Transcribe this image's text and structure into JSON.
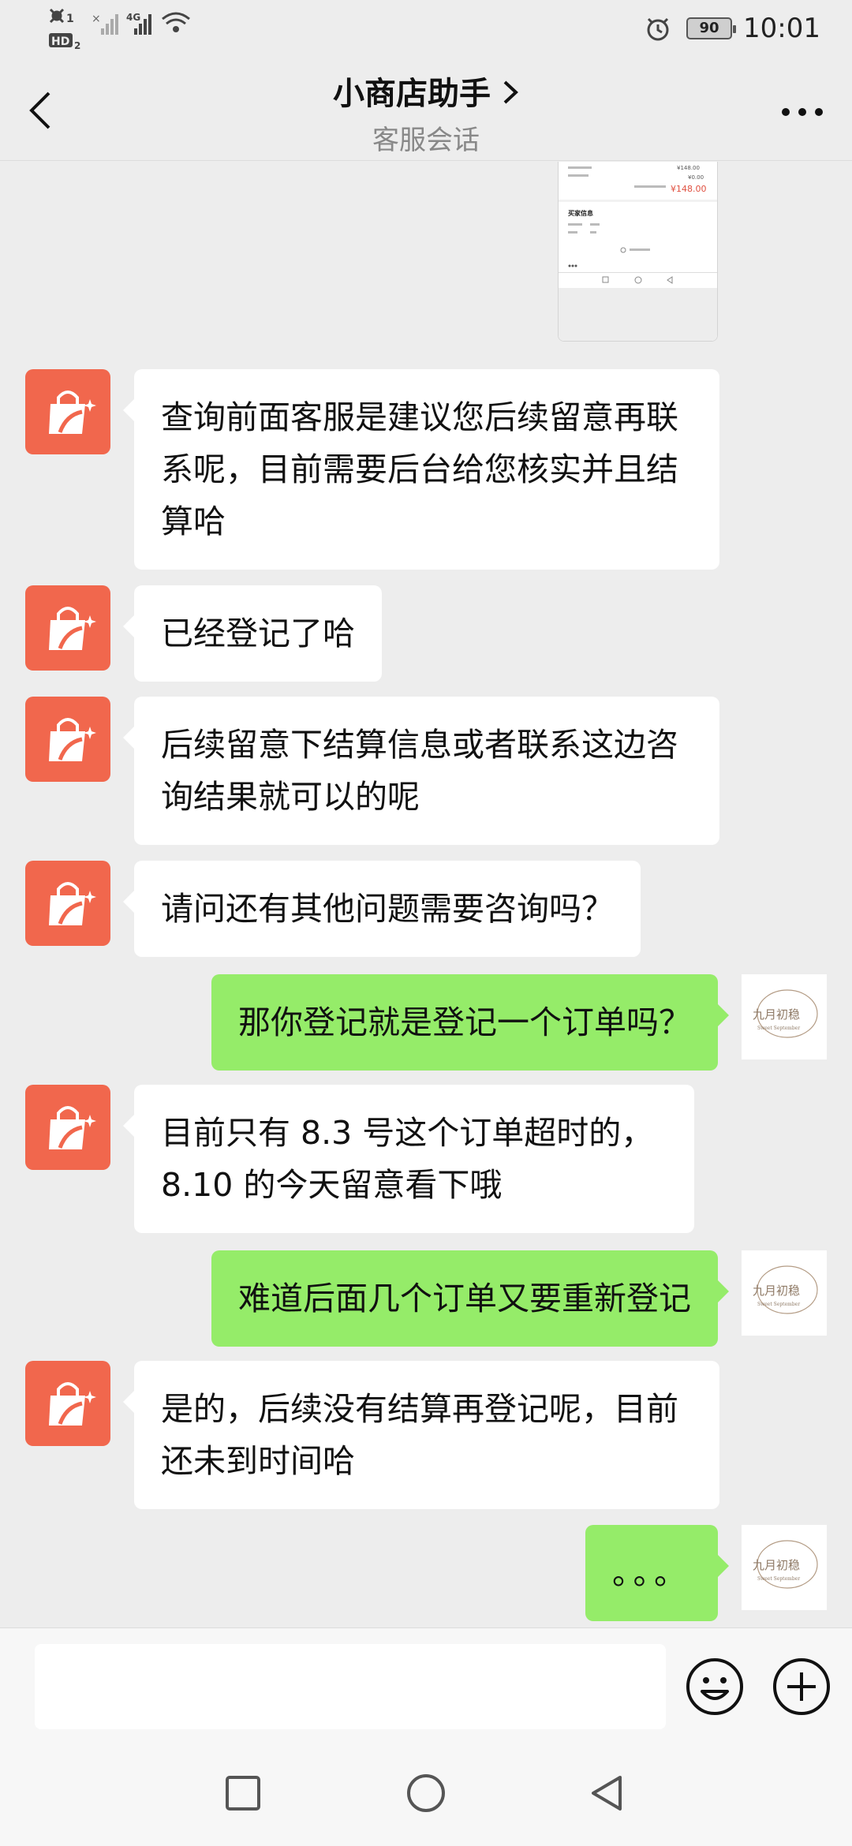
{
  "status_bar": {
    "sim1": "1",
    "hd": "HD",
    "hd_sub": "2",
    "network": "4G",
    "battery": "90",
    "time": "10:01"
  },
  "header": {
    "title": "小商店助手",
    "subtitle": "客服会话"
  },
  "screenshot_preview": {
    "amount": "¥148.00",
    "small_amount_1": "¥148.00",
    "small_amount_2": "¥0.00",
    "section_label": "买家信息"
  },
  "messages": [
    {
      "side": "left",
      "text": "查询前面客服是建议您后续留意再联系呢，目前需要后台给您核实并且结算哈"
    },
    {
      "side": "left",
      "text": "已经登记了哈"
    },
    {
      "side": "left",
      "text": "后续留意下结算信息或者联系这边咨询结果就可以的呢"
    },
    {
      "side": "left",
      "text": "请问还有其他问题需要咨询吗？"
    },
    {
      "side": "right",
      "text": "那你登记就是登记一个订单吗？"
    },
    {
      "side": "left",
      "text": "目前只有 8.3 号这个订单超时的，8.10 的今天留意看下哦"
    },
    {
      "side": "right",
      "text": "难道后面几个订单又要重新登记"
    },
    {
      "side": "left",
      "text": "是的，后续没有结算再登记呢，目前还未到时间哈"
    },
    {
      "side": "right",
      "text": "。。。"
    }
  ],
  "user_avatar_text": {
    "line1": "九月初稳",
    "line2": "Sweet September"
  },
  "input": {
    "value": "",
    "placeholder": ""
  },
  "colors": {
    "background": "#ededed",
    "bot_avatar": "#f1674d",
    "user_bubble": "#95ec69",
    "bot_bubble": "#ffffff"
  },
  "icons": {
    "back": "chevron-left-icon",
    "more": "more-dots-icon",
    "emoji": "smiley-icon",
    "plus": "plus-circle-icon"
  }
}
